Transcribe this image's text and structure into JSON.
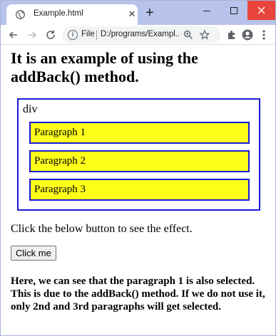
{
  "browser": {
    "tab_title": "Example.html",
    "address_scheme": "File",
    "address_url": "D:/programs/Exampl..."
  },
  "page": {
    "heading": "It is an example of using the addBack() method.",
    "div_label": "div",
    "paragraphs": [
      "Paragraph 1",
      "Paragraph 2",
      "Paragraph 3"
    ],
    "intro_text": "Click the below button to see the effect.",
    "button_label": "Click me",
    "result_text": "Here, we can see that the paragraph 1 is also selected. This is due to the addBack() method. If we do not use it, only 2nd and 3rd paragraphs will get selected."
  },
  "colors": {
    "tabstrip": "#b7c3ea",
    "paragraph_background": "#ffff1a",
    "border": "#1a1ad6",
    "close_button": "#e8443b"
  }
}
